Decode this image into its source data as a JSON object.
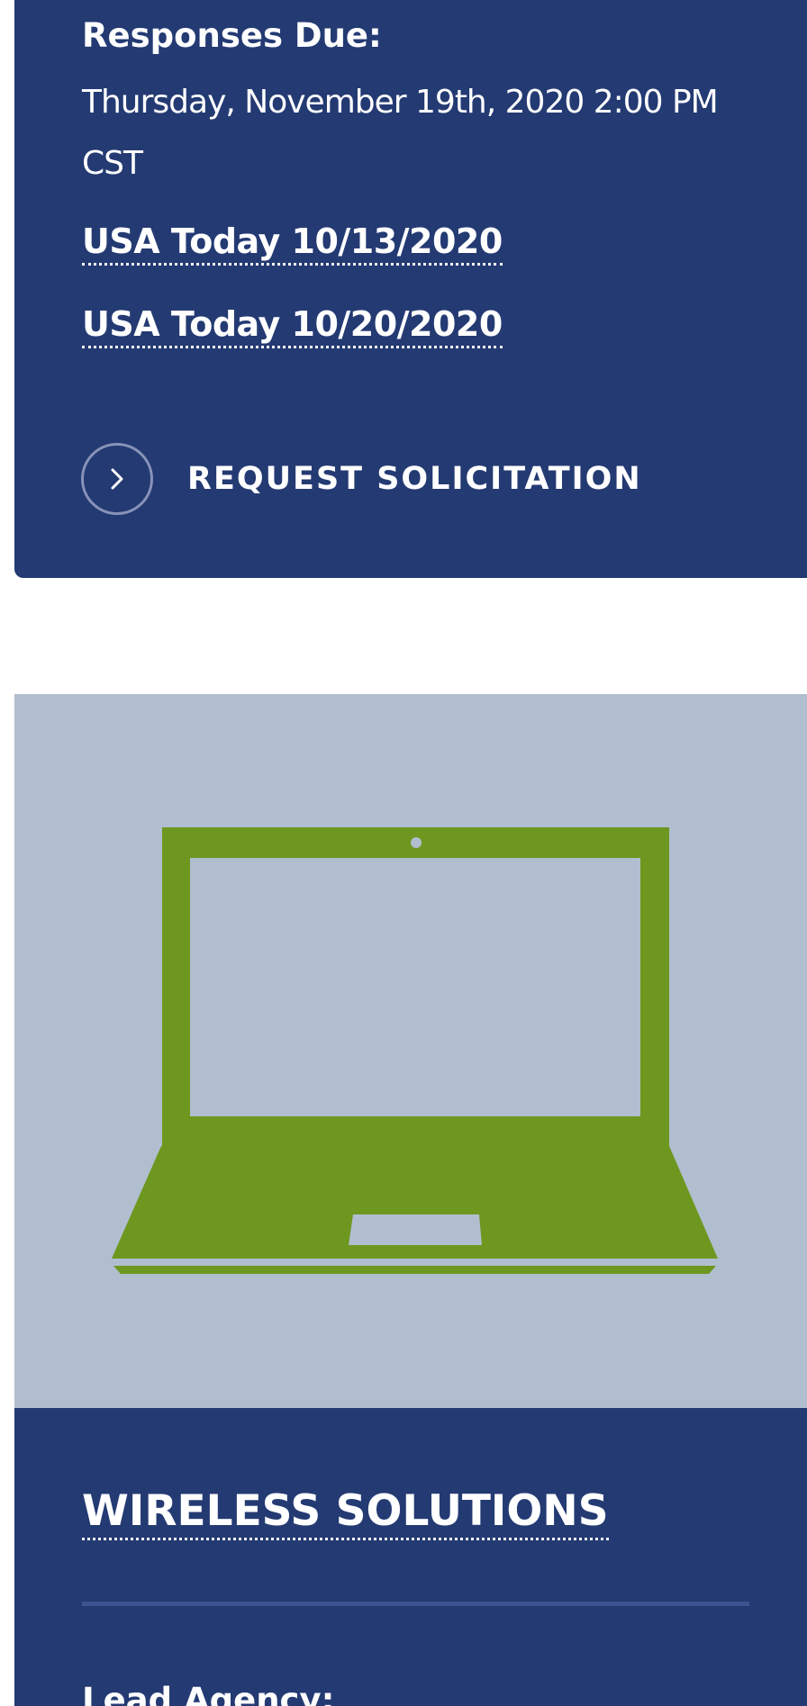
{
  "opportunity": {
    "responses_due_label": "Responses Due:",
    "responses_due_value": "Thursday, November 19th, 2020 2:00 PM CST",
    "links": [
      {
        "label": "USA Today 10/13/2020"
      },
      {
        "label": "USA Today 10/20/2020"
      }
    ],
    "request_button_label": "REQUEST SOLICITATION",
    "request_button_icon": "chevron-right-icon"
  },
  "next_card": {
    "image_icon": "laptop-icon",
    "title": "WIRELESS SOLUTIONS",
    "lead_agency_label": "Lead Agency:"
  },
  "colors": {
    "card_blue": "#243a73",
    "image_bg": "#b1becf",
    "laptop_green": "#6e971f"
  }
}
